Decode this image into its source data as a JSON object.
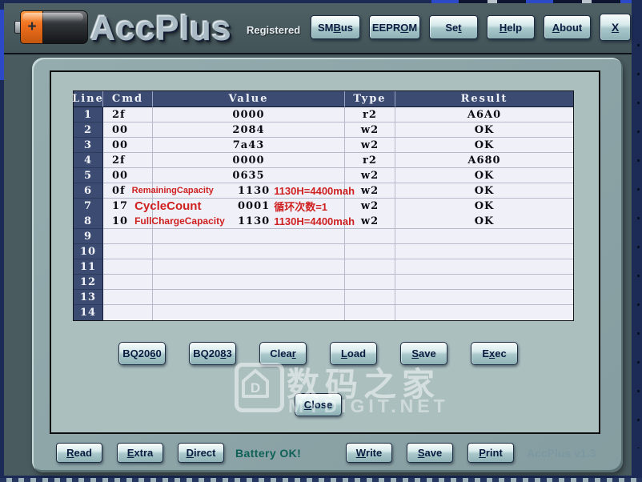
{
  "window": {
    "logo_text": "AccPlus",
    "registered_label": "Registered",
    "status_text": "Battery OK!",
    "version_text": "AccPlus v1.3"
  },
  "battery_icon": {
    "plus_label": "+"
  },
  "titlebar": {
    "buttons": [
      {
        "name": "smbus-button",
        "pre": "SM",
        "key": "B",
        "post": "us"
      },
      {
        "name": "eeprom-button",
        "pre": "EEPR",
        "key": "O",
        "post": "M"
      },
      {
        "name": "set-button",
        "pre": "Se",
        "key": "t",
        "post": ""
      },
      {
        "name": "help-button",
        "pre": "",
        "key": "H",
        "post": "elp"
      },
      {
        "name": "about-button",
        "pre": "",
        "key": "A",
        "post": "bout"
      },
      {
        "name": "close-window-button",
        "pre": "",
        "key": "X",
        "post": ""
      }
    ]
  },
  "table": {
    "headers": [
      "Line",
      "Cmd",
      "Value",
      "Type",
      "Result"
    ],
    "rows": [
      {
        "line": "1",
        "cmd": "2f",
        "value": "0000",
        "type": "r2",
        "result": "A6A0"
      },
      {
        "line": "2",
        "cmd": "00",
        "value": "2084",
        "type": "w2",
        "result": "OK"
      },
      {
        "line": "3",
        "cmd": "00",
        "value": "7a43",
        "type": "w2",
        "result": "OK"
      },
      {
        "line": "4",
        "cmd": "2f",
        "value": "0000",
        "type": "r2",
        "result": "A680"
      },
      {
        "line": "5",
        "cmd": "00",
        "value": "0635",
        "type": "w2",
        "result": "OK"
      },
      {
        "line": "6",
        "cmd": "0f",
        "cmd_note": "RemainingCapacity",
        "value": "1130",
        "value_note": "1130H=4400mah",
        "type": "w2",
        "result": "OK"
      },
      {
        "line": "7",
        "cmd": "17",
        "cmd_note": "CycleCount",
        "value": "0001",
        "value_note": "循环次数=1",
        "type": "w2",
        "result": "OK"
      },
      {
        "line": "8",
        "cmd": "10",
        "cmd_note": "FullChargeCapacity",
        "value": "1130",
        "value_note": "1130H=4400mah",
        "type": "w2",
        "result": "OK"
      },
      {
        "line": "9",
        "cmd": "",
        "value": "",
        "type": "",
        "result": ""
      },
      {
        "line": "10",
        "cmd": "",
        "value": "",
        "type": "",
        "result": ""
      },
      {
        "line": "11",
        "cmd": "",
        "value": "",
        "type": "",
        "result": ""
      },
      {
        "line": "12",
        "cmd": "",
        "value": "",
        "type": "",
        "result": ""
      },
      {
        "line": "13",
        "cmd": "",
        "value": "",
        "type": "",
        "result": ""
      },
      {
        "line": "14",
        "cmd": "",
        "value": "",
        "type": "",
        "result": ""
      }
    ]
  },
  "actions": {
    "buttons": [
      {
        "name": "bq2060-button",
        "pre": "BQ20",
        "key": "6",
        "post": "0"
      },
      {
        "name": "bq2083-button",
        "pre": "BQ20",
        "key": "8",
        "post": "3"
      },
      {
        "name": "clear-button",
        "pre": "Clea",
        "key": "r",
        "post": ""
      },
      {
        "name": "load-button",
        "pre": "",
        "key": "L",
        "post": "oad"
      },
      {
        "name": "save-button",
        "pre": "",
        "key": "S",
        "post": "ave"
      },
      {
        "name": "exec-button",
        "pre": "E",
        "key": "x",
        "post": "ec"
      }
    ]
  },
  "close_button": {
    "pre": "",
    "key": "C",
    "post": "lose"
  },
  "bottom": {
    "left_buttons": [
      {
        "name": "read-button",
        "pre": "",
        "key": "R",
        "post": "ead"
      },
      {
        "name": "extra-button",
        "pre": "",
        "key": "E",
        "post": "xtra"
      },
      {
        "name": "direct-button",
        "pre": "",
        "key": "D",
        "post": "irect"
      }
    ],
    "right_buttons": [
      {
        "name": "write-button",
        "pre": "",
        "key": "W",
        "post": "rite"
      },
      {
        "name": "save-file-button",
        "pre": "",
        "key": "S",
        "post": "ave"
      },
      {
        "name": "print-button",
        "pre": "",
        "key": "P",
        "post": "rint"
      }
    ]
  },
  "watermark": {
    "cjk_text": "数码之家",
    "latin_text": "MYDIGIT.NET",
    "logo_letter": "D"
  },
  "colors": {
    "window_border": "#1b2b56",
    "titlebar_bg": "#46585c",
    "panel_bg": "#8ca4a6",
    "inner_bg": "#abbfbf",
    "table_header_bg": "#3c4b71",
    "cell_bg": "#f0f1f8",
    "annotation_red": "#cf1f1f",
    "status_green": "#0f6158",
    "button_text": "#0a1c40",
    "battery_orange": "#ef6f1e"
  }
}
